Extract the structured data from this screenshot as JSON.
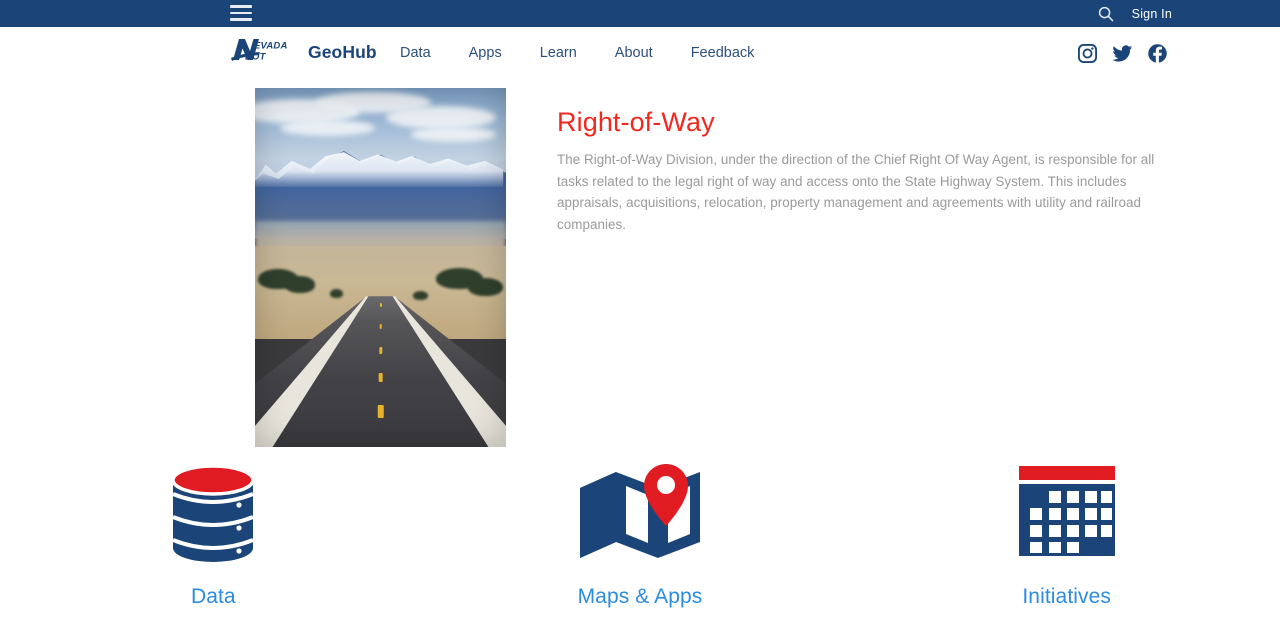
{
  "topbar": {
    "menu_icon": "hamburger-menu-icon",
    "search_icon": "search-icon",
    "signin_label": "Sign In"
  },
  "nav": {
    "logo_text": "NEVADA DOT",
    "brand": "GeoHub",
    "links": [
      {
        "label": "Data"
      },
      {
        "label": "Apps"
      },
      {
        "label": "Learn"
      },
      {
        "label": "About"
      },
      {
        "label": "Feedback"
      }
    ],
    "social": [
      {
        "name": "instagram-icon"
      },
      {
        "name": "twitter-icon"
      },
      {
        "name": "facebook-icon"
      }
    ]
  },
  "main": {
    "hero_image_alt": "Desert highway leading toward snow-capped mountains",
    "title": "Right-of-Way",
    "description": "The Right-of-Way Division, under the direction of the Chief Right Of Way Agent, is responsible for all tasks related to the legal right of way and access onto the State Highway System. This includes appraisals, acquisitions, relocation, property management and agreements with utility and railroad companies."
  },
  "tiles": [
    {
      "label": "Data",
      "icon": "database-icon"
    },
    {
      "label": "Maps & Apps",
      "icon": "map-pin-icon"
    },
    {
      "label": "Initiatives",
      "icon": "calendar-icon"
    }
  ],
  "colors": {
    "navy": "#1b4478",
    "red": "#f2281e",
    "link_blue": "#2b8ce0",
    "nav_text": "#2d4f7c",
    "body_text": "#9a9a9a"
  }
}
